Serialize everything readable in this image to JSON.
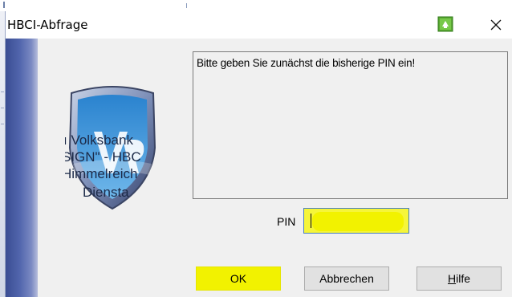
{
  "window": {
    "title": "HBCI-Abfrage",
    "close_label": "✕"
  },
  "logo": {
    "lines": [
      "ı Volksbank",
      "SIGN\" - HBC",
      "Himmelreich",
      "Diensta"
    ]
  },
  "message": {
    "text": "Bitte geben Sie zunächst die bisherige PIN ein!"
  },
  "pin": {
    "label": "PIN",
    "value": ""
  },
  "buttons": {
    "ok": "OK",
    "cancel": "Abbrechen",
    "help_prefix": "",
    "help_mnemonic": "H",
    "help_rest": "ilfe"
  },
  "colors": {
    "highlight": "#f2f200",
    "stripe": "#3a4d93",
    "focus_border": "#4a7fc0"
  }
}
